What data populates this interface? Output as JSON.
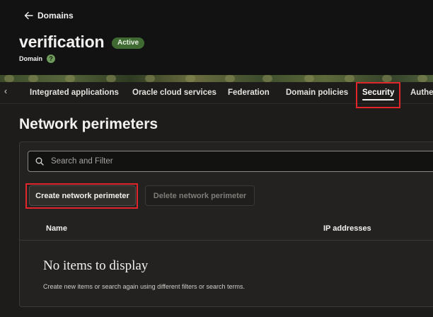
{
  "header": {
    "back_label": "Domains",
    "title": "verification",
    "status_badge": "Active",
    "subtitle": "Domain",
    "help_glyph": "?"
  },
  "tabs": {
    "scroll_left_glyph": "‹",
    "items": [
      {
        "label": "Integrated applications"
      },
      {
        "label": "Oracle cloud services"
      },
      {
        "label": "Federation"
      },
      {
        "label": "Domain policies"
      },
      {
        "label": "Security",
        "active": true
      },
      {
        "label": "Authe"
      }
    ]
  },
  "main": {
    "section_title": "Network perimeters",
    "search": {
      "placeholder": "Search and Filter",
      "value": ""
    },
    "create_button": "Create network perimeter",
    "delete_button": "Delete network perimeter",
    "table": {
      "columns": [
        "Name",
        "IP addresses"
      ],
      "empty_title": "No items to display",
      "empty_description": "Create new items or search again using different filters or search terms."
    }
  },
  "colors": {
    "highlight": "#e0252b",
    "badge_bg": "#3f6b33",
    "background": "#1d1c1a"
  }
}
